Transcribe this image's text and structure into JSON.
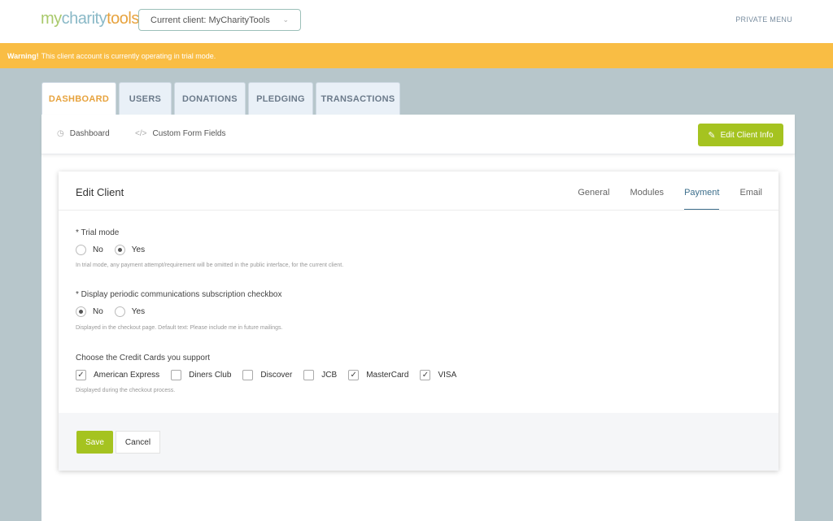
{
  "header": {
    "logo": {
      "part1": "my",
      "part2": "charity",
      "part3": "tools"
    },
    "client_select": "Current client: MyCharityTools",
    "private_menu": "PRIVATE MENU"
  },
  "warning": {
    "strong": "Warning!",
    "text": "This client account is currently operating in trial mode."
  },
  "tabs": [
    {
      "label": "DASHBOARD",
      "active": true
    },
    {
      "label": "USERS"
    },
    {
      "label": "DONATIONS"
    },
    {
      "label": "PLEDGING"
    },
    {
      "label": "TRANSACTIONS"
    }
  ],
  "subnav": {
    "items": [
      {
        "label": "Dashboard",
        "icon": "clock-icon"
      },
      {
        "label": "Custom Form Fields",
        "icon": "code-icon"
      }
    ],
    "edit_button": "Edit Client Info"
  },
  "card": {
    "title": "Edit Client",
    "tabs": [
      {
        "label": "General"
      },
      {
        "label": "Modules"
      },
      {
        "label": "Payment",
        "active": true
      },
      {
        "label": "Email"
      }
    ],
    "trial_mode": {
      "label": "* Trial mode",
      "options": [
        "No",
        "Yes"
      ],
      "selected": "Yes",
      "help": "In trial mode, any payment attempt/requirement will be omitted in the public interface, for the current client."
    },
    "subscription": {
      "label": "* Display periodic communications subscription checkbox",
      "options": [
        "No",
        "Yes"
      ],
      "selected": "No",
      "help": "Displayed in the checkout page. Default text: Please include me in future mailings."
    },
    "credit_cards": {
      "label": "Choose the Credit Cards you support",
      "options": [
        {
          "label": "American Express",
          "checked": true
        },
        {
          "label": "Diners Club",
          "checked": false
        },
        {
          "label": "Discover",
          "checked": false
        },
        {
          "label": "JCB",
          "checked": false
        },
        {
          "label": "MasterCard",
          "checked": true
        },
        {
          "label": "VISA",
          "checked": true
        }
      ],
      "help": "Displayed during the checkout process."
    },
    "save_label": "Save",
    "cancel_label": "Cancel"
  },
  "colors": {
    "accent_green": "#a5c320",
    "warning_yellow": "#f9bd44",
    "tab_active": "#e7a33e",
    "payment_tab": "#3d6f8c"
  }
}
